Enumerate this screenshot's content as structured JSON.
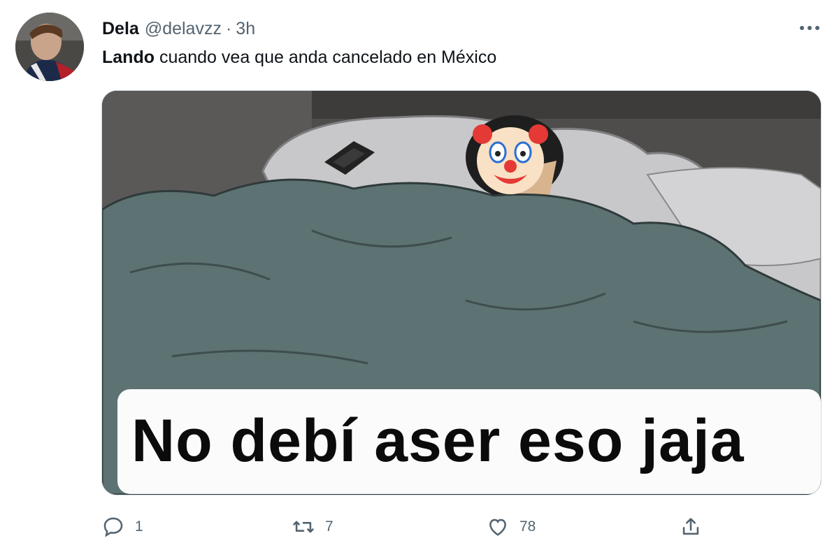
{
  "tweet": {
    "author_name": "Dela",
    "handle": "@delavzz",
    "separator": "·",
    "time": "3h",
    "text_bold": "Lando",
    "text_rest": " cuando vea que anda cancelado en México"
  },
  "media": {
    "caption": "No debí aser eso jaja",
    "emoji": "🤡"
  },
  "actions": {
    "reply_count": "1",
    "retweet_count": "7",
    "like_count": "78"
  },
  "colors": {
    "secondary_text": "#536471",
    "border": "#cfd9de",
    "blanket": "#5d7272",
    "pillow": "#c8c8ca"
  },
  "icons": [
    "more-icon",
    "reply-icon",
    "retweet-icon",
    "like-icon",
    "share-icon"
  ]
}
